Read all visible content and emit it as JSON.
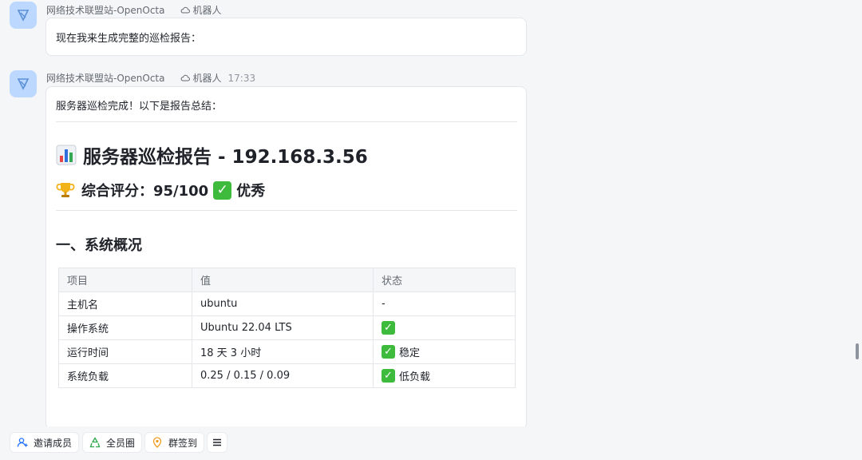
{
  "messages": [
    {
      "sender": "网络技术联盟站-OpenOcta",
      "bot_label": "机器人",
      "time": "",
      "text": "现在我来生成完整的巡检报告："
    },
    {
      "sender": "网络技术联盟站-OpenOcta",
      "bot_label": "机器人",
      "time": "17:33",
      "intro": "服务器巡检完成！以下是报告总结：",
      "report_title": "服务器巡检报告 - 192.168.3.56",
      "score_label": "综合评分：95/100",
      "score_verdict": "优秀",
      "section_title": "一、系统概况",
      "table": {
        "headers": [
          "项目",
          "值",
          "状态"
        ],
        "rows": [
          {
            "item": "主机名",
            "value": "ubuntu",
            "status": "-",
            "ok": false
          },
          {
            "item": "操作系统",
            "value": "Ubuntu 22.04 LTS",
            "status": "",
            "ok": true
          },
          {
            "item": "运行时间",
            "value": "18 天 3 小时",
            "status": "稳定",
            "ok": true
          },
          {
            "item": "系统负载",
            "value": "0.25 / 0.15 / 0.09",
            "status": "低负载",
            "ok": true
          }
        ]
      }
    }
  ],
  "toolbar": {
    "invite": "邀请成员",
    "circle": "全员圈",
    "checkin": "群签到"
  },
  "icons": {
    "avatar": "bot-avatar-icon",
    "bot": "cloud-icon",
    "chart": "bar-chart-icon",
    "trophy": "trophy-icon",
    "check": "check-mark-icon",
    "invite": "add-person-icon",
    "circle": "recycle-icon",
    "checkin": "location-pin-icon",
    "menu": "hamburger-menu-icon"
  },
  "colors": {
    "accent": "#1e6fff",
    "check_green": "#3ebb3c",
    "bubble_border": "#e4e6ea",
    "background": "#f5f6f7"
  }
}
